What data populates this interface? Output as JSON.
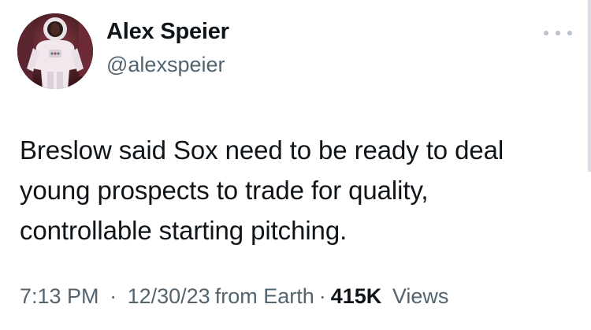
{
  "author": {
    "name": "Alex Speier",
    "handle": "@alexspeier"
  },
  "tweet": {
    "lines": [
      "Breslow said Sox need to be ready to deal",
      "young prospects to trade for quality,",
      "controllable starting pitching."
    ]
  },
  "meta": {
    "time": "7:13 PM",
    "separator": "·",
    "date": "12/30/23",
    "location": "from Earth",
    "views_count": "415K",
    "views_label": "Views"
  },
  "icons": {
    "more": "more-horizontal-icon",
    "avatar": "astronaut-avatar"
  },
  "colors": {
    "text_primary": "#0f1419",
    "text_secondary": "#536471",
    "more_dots": "#b8c2cc"
  }
}
